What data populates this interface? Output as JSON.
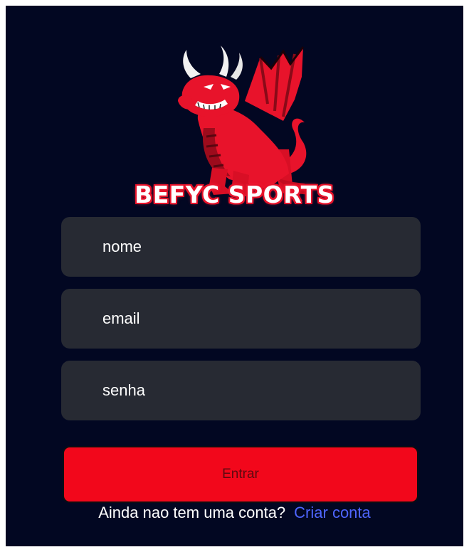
{
  "brand": {
    "name": "BEFYC SPORTS",
    "logo_icon": "red-dragon-icon",
    "accent_color": "#f2071b"
  },
  "form": {
    "name_placeholder": "nome",
    "email_placeholder": "email",
    "password_placeholder": "senha",
    "submit_label": "Entrar"
  },
  "footer": {
    "prompt": "Ainda nao tem uma conta?",
    "link_label": "Criar conta",
    "link_color": "#4e65ff"
  },
  "colors": {
    "background": "#020722",
    "field_background": "#272a33"
  }
}
